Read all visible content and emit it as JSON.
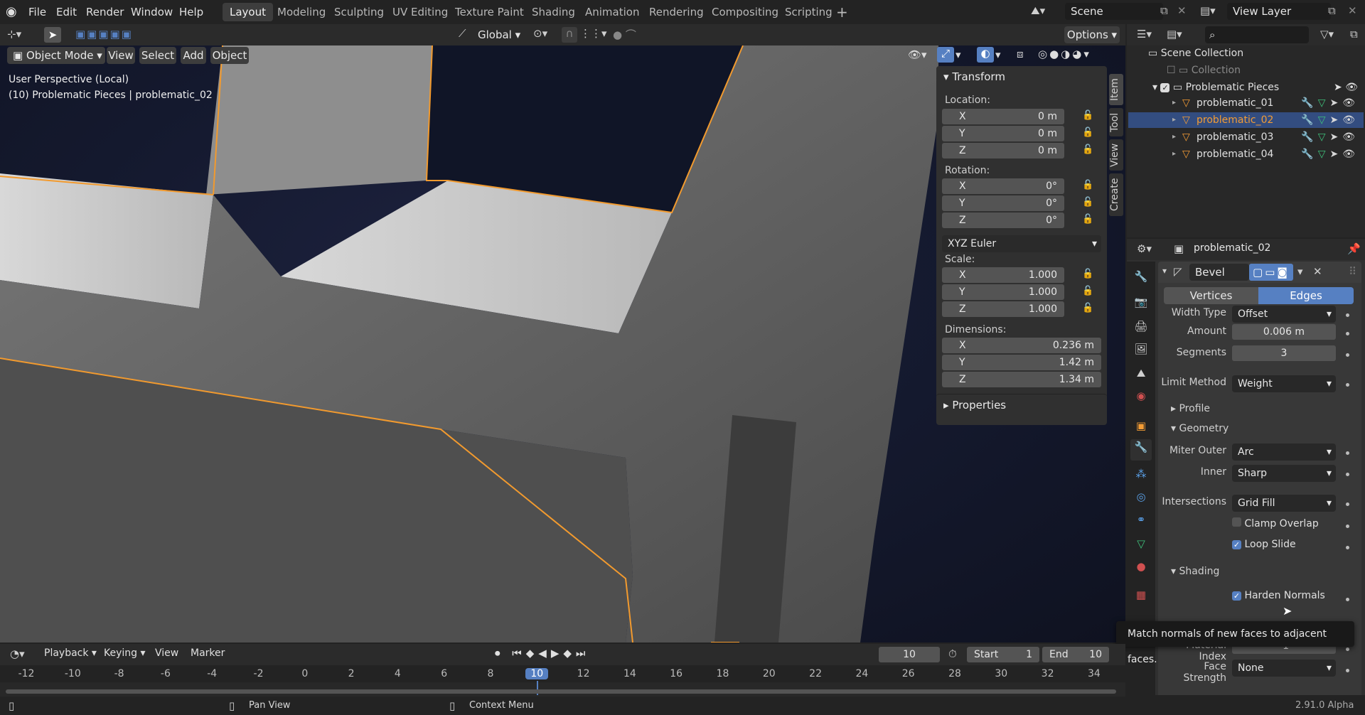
{
  "menu": [
    "File",
    "Edit",
    "Render",
    "Window",
    "Help"
  ],
  "workspaces": [
    "Layout",
    "Modeling",
    "Sculpting",
    "UV Editing",
    "Texture Paint",
    "Shading",
    "Animation",
    "Rendering",
    "Compositing",
    "Scripting"
  ],
  "scene_name": "Scene",
  "view_layer": "View Layer",
  "header": {
    "orientation": "Global",
    "options": "Options"
  },
  "viewport": {
    "mode": "Object Mode",
    "menus": [
      "View",
      "Select",
      "Add",
      "Object"
    ],
    "info_line1": "User Perspective (Local)",
    "info_line2": "(10) Problematic Pieces | problematic_02"
  },
  "sidebar_tabs": [
    "Item",
    "Tool",
    "View",
    "Create"
  ],
  "transform": {
    "title": "Transform",
    "location_label": "Location:",
    "location": [
      {
        "axis": "X",
        "value": "0 m"
      },
      {
        "axis": "Y",
        "value": "0 m"
      },
      {
        "axis": "Z",
        "value": "0 m"
      }
    ],
    "rotation_label": "Rotation:",
    "rotation": [
      {
        "axis": "X",
        "value": "0°"
      },
      {
        "axis": "Y",
        "value": "0°"
      },
      {
        "axis": "Z",
        "value": "0°"
      }
    ],
    "rotation_mode": "XYZ Euler",
    "scale_label": "Scale:",
    "scale": [
      {
        "axis": "X",
        "value": "1.000"
      },
      {
        "axis": "Y",
        "value": "1.000"
      },
      {
        "axis": "Z",
        "value": "1.000"
      }
    ],
    "dimensions_label": "Dimensions:",
    "dimensions": [
      {
        "axis": "X",
        "value": "0.236 m"
      },
      {
        "axis": "Y",
        "value": "1.42 m"
      },
      {
        "axis": "Z",
        "value": "1.34 m"
      }
    ],
    "properties": "Properties"
  },
  "outliner": {
    "root": "Scene Collection",
    "collection": "Collection",
    "group": "Problematic Pieces",
    "items": [
      "problematic_01",
      "problematic_02",
      "problematic_03",
      "problematic_04"
    ]
  },
  "properties": {
    "object_name": "problematic_02",
    "modifier_name": "Bevel",
    "affect": [
      "Vertices",
      "Edges"
    ],
    "width_type_label": "Width Type",
    "width_type": "Offset",
    "amount_label": "Amount",
    "amount": "0.006 m",
    "segments_label": "Segments",
    "segments": "3",
    "limit_label": "Limit Method",
    "limit": "Weight",
    "profile": "Profile",
    "geometry": "Geometry",
    "miter_outer_label": "Miter Outer",
    "miter_outer": "Arc",
    "inner_label": "Inner",
    "inner": "Sharp",
    "intersections_label": "Intersections",
    "intersections": "Grid Fill",
    "clamp": "Clamp Overlap",
    "loop_slide": "Loop Slide",
    "shading": "Shading",
    "harden": "Harden Normals",
    "tooltip": "Match normals of new faces to adjacent faces.",
    "material_label": "Material Index",
    "material": "-1",
    "face_strength_label": "Face Strength",
    "face_strength": "None"
  },
  "timeline": {
    "menus": [
      "Playback",
      "Keying",
      "View",
      "Marker"
    ],
    "current": "10",
    "start_label": "Start",
    "start": "1",
    "end_label": "End",
    "end": "10",
    "ticks": [
      "-12",
      "-10",
      "-8",
      "-6",
      "-4",
      "-2",
      "0",
      "2",
      "4",
      "6",
      "8",
      "10",
      "12",
      "14",
      "16",
      "18",
      "20",
      "22",
      "24",
      "26",
      "28",
      "30",
      "32",
      "34"
    ]
  },
  "status": {
    "pan": "Pan View",
    "context": "Context Menu",
    "version": "2.91.0 Alpha"
  }
}
